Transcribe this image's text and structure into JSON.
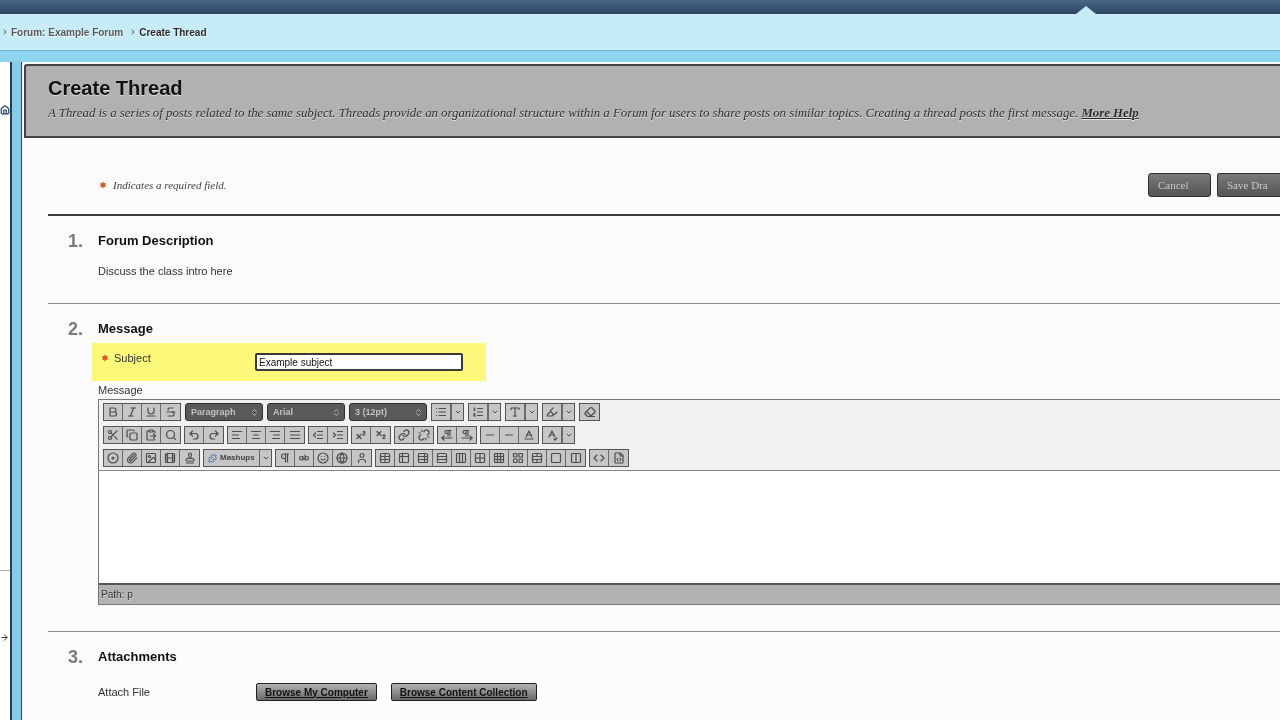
{
  "breadcrumb": [
    {
      "label": "Forum: Example Forum"
    },
    {
      "label": "Create Thread"
    }
  ],
  "header": {
    "title": "Create Thread",
    "description": "A Thread is a series of posts related to the same subject. Threads provide an organizational structure within a Forum for users to share posts on similar topics. Creating a thread posts the first message.",
    "link": "More Help"
  },
  "required_note": "Indicates a required field.",
  "actions": [
    "Cancel",
    "Save Dra"
  ],
  "sections": [
    {
      "number": "1.",
      "title": "Forum Description",
      "kind": "text",
      "text": "Discuss the class intro here"
    },
    {
      "number": "2.",
      "title": "Message",
      "kind": "message",
      "fields": [
        {
          "label": "Subject",
          "required": true,
          "focused": true,
          "value": "Example subject"
        }
      ],
      "editor": {
        "label": "Message",
        "dropdowns": [
          "Paragraph",
          "Arial",
          "3 (12pt)"
        ],
        "mashups": "Mashups",
        "path": "Path: p"
      }
    },
    {
      "number": "3.",
      "title": "Attachments",
      "kind": "attachments",
      "label": "Attach File",
      "buttons": [
        "Browse My Computer",
        "Browse Content Collection"
      ]
    }
  ]
}
